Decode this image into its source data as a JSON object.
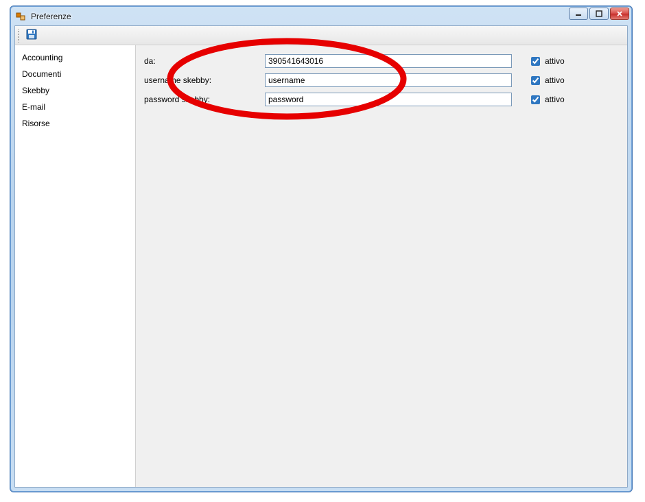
{
  "window": {
    "title": "Preferenze"
  },
  "sidebar": {
    "items": [
      {
        "label": "Accounting"
      },
      {
        "label": "Documenti"
      },
      {
        "label": "Skebby"
      },
      {
        "label": "E-mail"
      },
      {
        "label": "Risorse"
      }
    ]
  },
  "form": {
    "rows": [
      {
        "label": "da:",
        "value": "390541643016",
        "active_label": "attivo",
        "active": true
      },
      {
        "label": "username skebby:",
        "value": "username",
        "active_label": "attivo",
        "active": true
      },
      {
        "label": "password skebby:",
        "value": "password",
        "active_label": "attivo",
        "active": true
      }
    ]
  },
  "annotation": {
    "color": "#e60000"
  }
}
